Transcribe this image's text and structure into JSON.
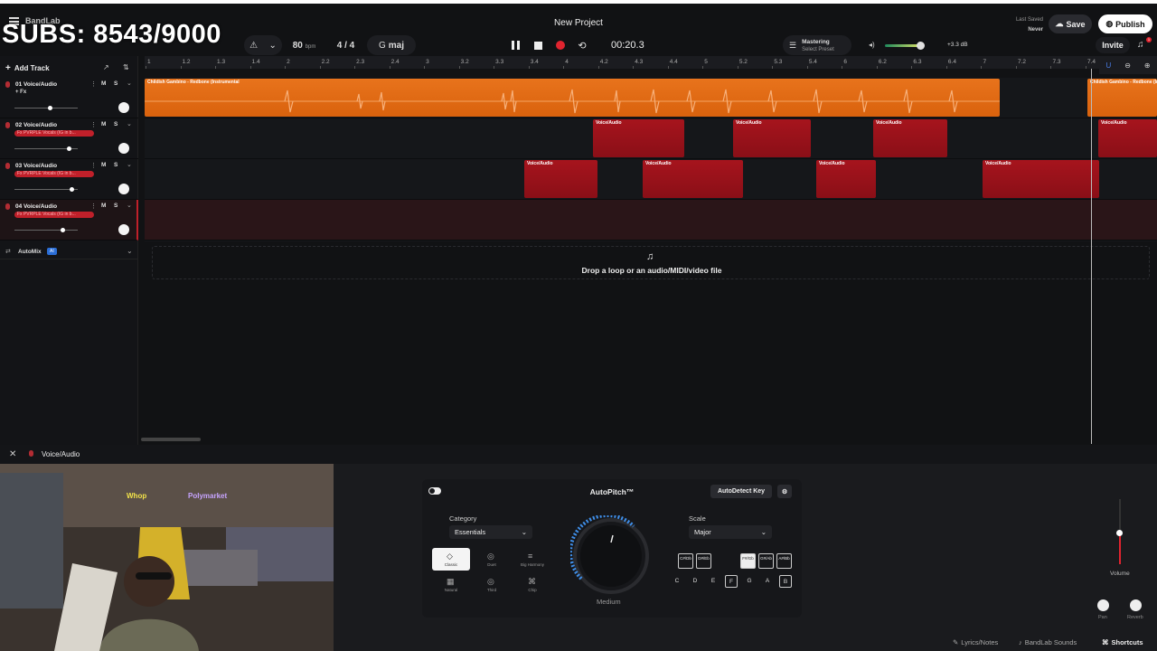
{
  "app": {
    "brand": "BandLab",
    "project_title": "New Project",
    "overlay_subs": "SUBS: 8543/9000"
  },
  "toolbar": {
    "bpm_value": "80",
    "bpm_unit": "bpm",
    "time_signature": "4 / 4",
    "key": "maj",
    "time": "00:20.3",
    "mastering_label": "Mastering",
    "mastering_sub": "Select Preset",
    "volume_db": "+3.3 dB",
    "last_saved_label": "Last Saved",
    "last_saved_value": "Never",
    "save_label": "Save",
    "publish_label": "Publish",
    "invite_label": "Invite",
    "notification_count": "1"
  },
  "left": {
    "add_track_label": "Add Track",
    "automix_label": "AutoMix",
    "automix_badge": "AI"
  },
  "tracks": [
    {
      "name": "01  Voice/Audio",
      "fx": "+ Fx",
      "fx_active": false,
      "mute": "M",
      "solo": "S",
      "volume": 0.55
    },
    {
      "name": "02  Voice/Audio",
      "fx": "Fx PVRPLE Vocals (IG in b...",
      "fx_active": true,
      "mute": "M",
      "solo": "S",
      "volume": 0.85
    },
    {
      "name": "03  Voice/Audio",
      "fx": "Fx PVRPLE Vocals (IG in b...",
      "fx_active": true,
      "mute": "M",
      "solo": "S",
      "volume": 0.9
    },
    {
      "name": "04  Voice/Audio",
      "fx": "Fx PVRPLE Vocals (IG in b...",
      "fx_active": true,
      "mute": "M",
      "solo": "S",
      "volume": 0.75
    }
  ],
  "ruler": [
    "1",
    "1.2",
    "1.3",
    "1.4",
    "2",
    "2.2",
    "2.3",
    "2.4",
    "3",
    "3.2",
    "3.3",
    "3.4",
    "4",
    "4.2",
    "4.3",
    "4.4",
    "5",
    "5.2",
    "5.3",
    "5.4",
    "6",
    "6.2",
    "6.3",
    "6.4",
    "7",
    "7.2",
    "7.3",
    "7.4"
  ],
  "clips": {
    "instrumental": "Childish Gambino - Redbone (Instrumental",
    "voice": "Voice/Audio"
  },
  "dropzone": {
    "text": "Drop a loop or an audio/MIDI/video file"
  },
  "bottom": {
    "track_label": "Voice/Audio"
  },
  "autopitch": {
    "title": "AutoPitch™",
    "detect_key_label": "AutoDetect Key",
    "category_label": "Category",
    "category_value": "Essentials",
    "scale_label": "Scale",
    "scale_value": "Major",
    "knob_label": "Medium",
    "modes": [
      "Classic",
      "Duet",
      "Big Harmony",
      "Natural",
      "Third",
      "Chip"
    ],
    "sharps": [
      "C#/Db",
      "D#/Eb",
      "F#/Gb",
      "G#/Ab",
      "A#/Bb"
    ],
    "notes": [
      "C",
      "D",
      "E",
      "F",
      "G",
      "A",
      "B"
    ]
  },
  "mixer": {
    "volume_label": "Volume",
    "pan_label": "Pan",
    "reverb_label": "Reverb"
  },
  "statusbar": {
    "lyrics_label": "Lyrics/Notes",
    "sounds_label": "BandLab Sounds",
    "shortcuts_label": "Shortcuts"
  },
  "colors": {
    "accent_orange": "#e8731c",
    "clip_red": "#a6141d",
    "record_red": "#e0242f"
  }
}
